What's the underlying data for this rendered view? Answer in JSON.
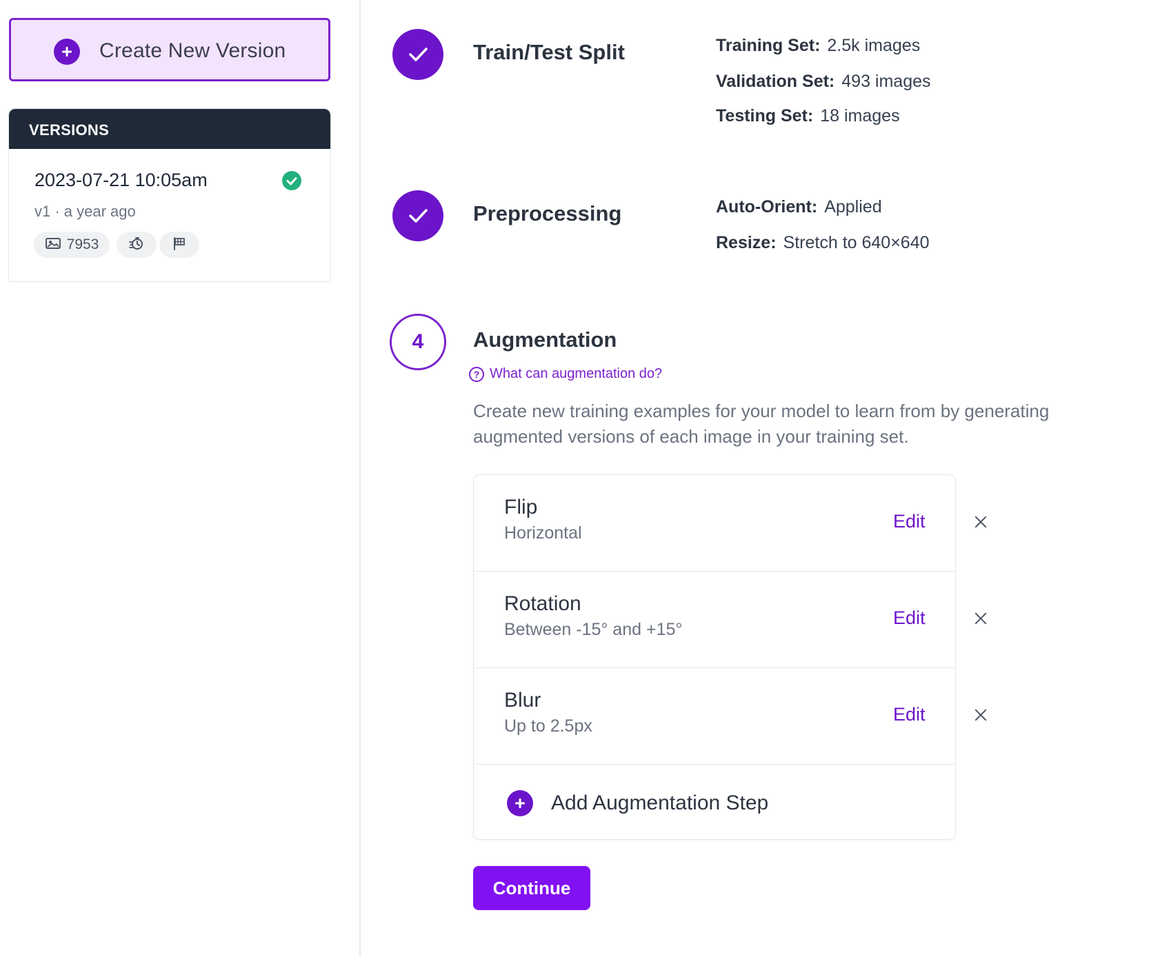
{
  "sidebar": {
    "create_button_label": "Create New Version",
    "versions_header": "VERSIONS",
    "versions": [
      {
        "date": "2023-07-21 10:05am",
        "subtitle": "v1 · a year ago",
        "image_count": "7953",
        "status": "complete"
      }
    ]
  },
  "steps": {
    "split": {
      "title": "Train/Test Split",
      "rows": [
        {
          "key": "Training Set:",
          "value": "2.5k images"
        },
        {
          "key": "Validation Set:",
          "value": "493 images"
        },
        {
          "key": "Testing Set:",
          "value": "18 images"
        }
      ]
    },
    "preprocessing": {
      "title": "Preprocessing",
      "rows": [
        {
          "key": "Auto-Orient:",
          "value": "Applied"
        },
        {
          "key": "Resize:",
          "value": "Stretch to 640×640"
        }
      ]
    },
    "augmentation": {
      "number": "4",
      "title": "Augmentation",
      "help_link": "What can augmentation do?",
      "description": "Create new training examples for your model to learn from by generating augmented versions of each image in your training set.",
      "items": [
        {
          "name": "Flip",
          "detail": "Horizontal",
          "edit_label": "Edit"
        },
        {
          "name": "Rotation",
          "detail": "Between -15° and +15°",
          "edit_label": "Edit"
        },
        {
          "name": "Blur",
          "detail": "Up to 2.5px",
          "edit_label": "Edit"
        }
      ],
      "add_step_label": "Add Augmentation Step",
      "continue_label": "Continue"
    }
  },
  "colors": {
    "accent": "#6c14c9",
    "accent_bright": "#8111f2",
    "success": "#22b07d",
    "header_dark": "#1f2937"
  },
  "icons": [
    "plus-icon",
    "check-icon",
    "image-icon",
    "timer-icon",
    "flag-icon",
    "question-icon",
    "close-icon"
  ]
}
